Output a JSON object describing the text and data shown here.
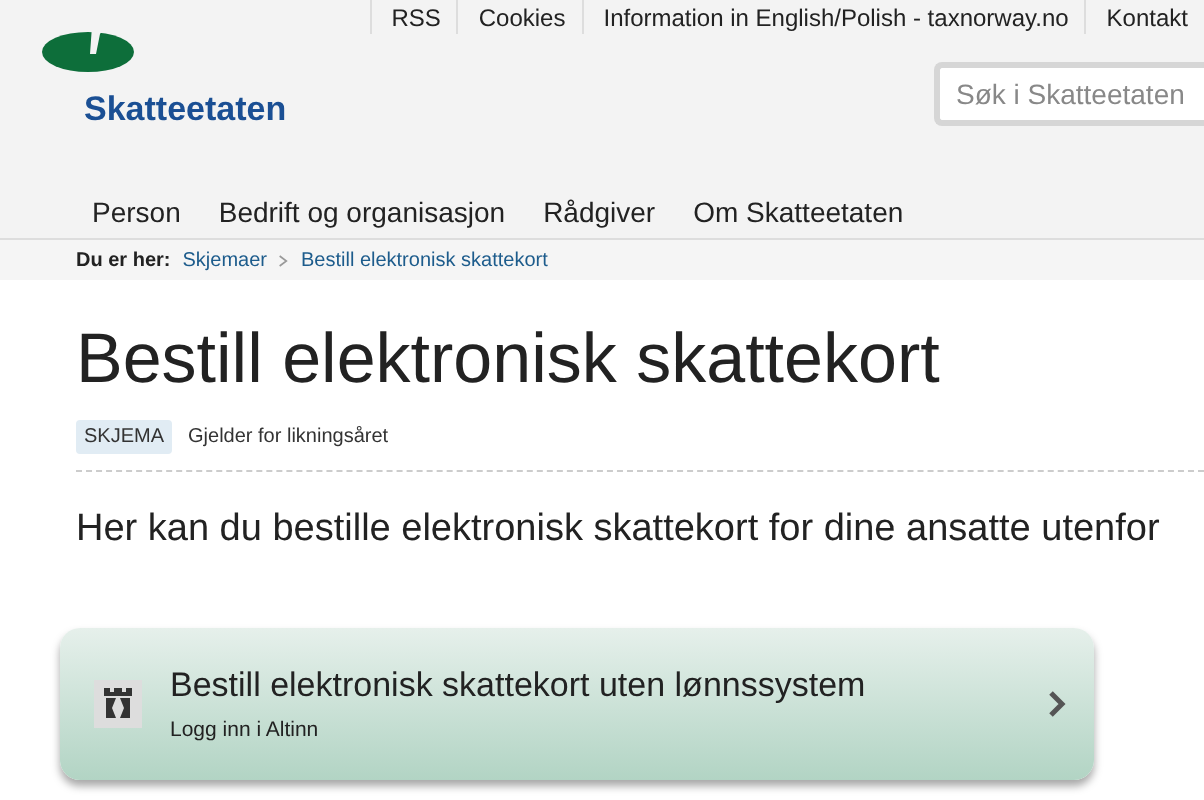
{
  "top_links": [
    "RSS",
    "Cookies",
    "Information in English/Polish - taxnorway.no",
    "Kontakt"
  ],
  "logo": {
    "text": "Skatteetaten"
  },
  "search": {
    "placeholder": "Søk i Skatteetaten"
  },
  "nav": [
    "Person",
    "Bedrift og organisasjon",
    "Rådgiver",
    "Om Skatteetaten"
  ],
  "breadcrumb": {
    "label": "Du er her:",
    "items": [
      "Skjemaer",
      "Bestill elektronisk skattekort"
    ]
  },
  "title": "Bestill elektronisk skattekort",
  "tag": "SKJEMA",
  "tag_note": "Gjelder for likningsåret",
  "intro": "Her kan du bestille elektronisk skattekort for dine ansatte utenfor",
  "card": {
    "title": "Bestill elektronisk skattekort uten lønnssystem",
    "subtitle": "Logg inn i Altinn"
  }
}
